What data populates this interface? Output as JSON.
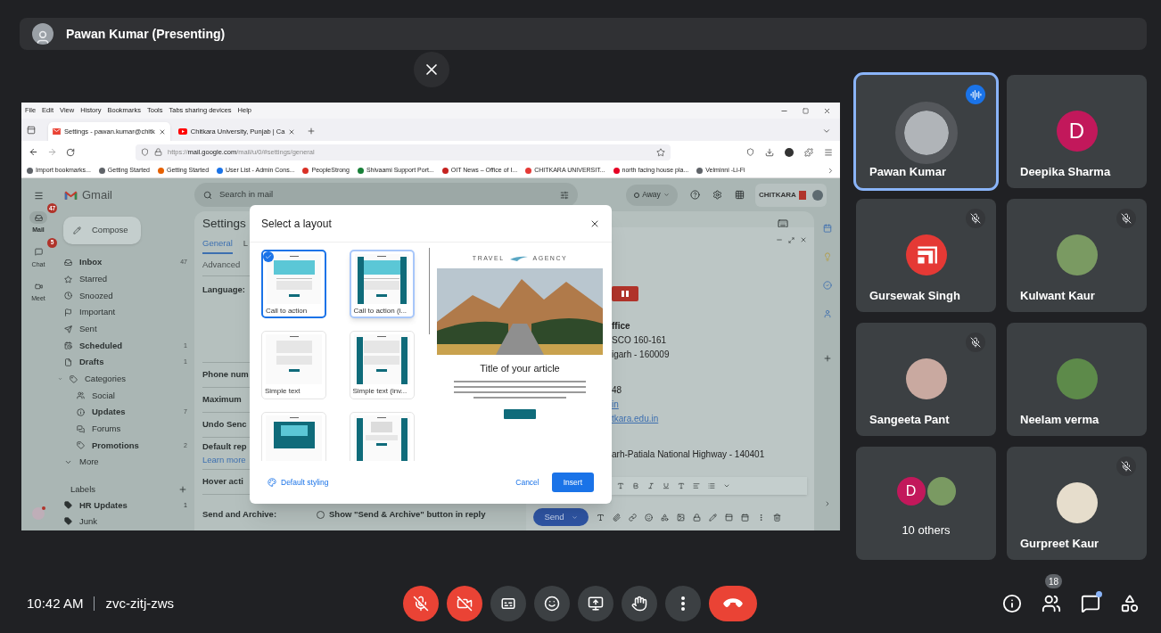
{
  "top_bar": {
    "presenter": "Pawan Kumar (Presenting)"
  },
  "shared_screen": {
    "menu": [
      "File",
      "Edit",
      "View",
      "History",
      "Bookmarks",
      "Tools",
      "Tabs sharing devices",
      "Help"
    ],
    "tabs": [
      {
        "title": "Settings - pawan.kumar@chitk",
        "selected": true
      },
      {
        "title": "Chitkara University, Punjab | Ca",
        "selected": false
      }
    ],
    "url": "https://**mail.google.com**/mail/u/0/#settings/general",
    "bookmarks": [
      {
        "label": "Import bookmarks...",
        "color": "#5f6368"
      },
      {
        "label": "Getting Started",
        "color": "#5f6368"
      },
      {
        "label": "Getting Started",
        "color": "#e66000"
      },
      {
        "label": "User List - Admin Cons...",
        "color": "#1a73e8"
      },
      {
        "label": "PeopleStrong",
        "color": "#d93025"
      },
      {
        "label": "Shivaami Support Port...",
        "color": "#188038"
      },
      {
        "label": "OIT News – Office of I...",
        "color": "#c5221f"
      },
      {
        "label": "CHITKARA UNIVERSIT...",
        "color": "#e53935"
      },
      {
        "label": "north facing house pla...",
        "color": "#e60023"
      },
      {
        "label": "Velminni -Li-Fi",
        "color": "#5f6368"
      }
    ],
    "gmail": {
      "app_name": "Gmail",
      "rail": [
        {
          "label": "Mail",
          "badge": "47",
          "selected": true
        },
        {
          "label": "Chat",
          "badge": "5",
          "selected": false
        },
        {
          "label": "Meet",
          "selected": false
        }
      ],
      "compose": "Compose",
      "nav": [
        {
          "label": "Inbox",
          "count": "47",
          "unread": true
        },
        {
          "label": "Starred",
          "unread": false
        },
        {
          "label": "Snoozed",
          "unread": false
        },
        {
          "label": "Important",
          "unread": false
        },
        {
          "label": "Sent",
          "unread": false
        },
        {
          "label": "Scheduled",
          "count": "1",
          "unread": true
        },
        {
          "label": "Drafts",
          "count": "1",
          "unread": true
        },
        {
          "label": "Categories",
          "unread": false,
          "expanded": true,
          "children": [
            {
              "label": "Social",
              "unread": false
            },
            {
              "label": "Updates",
              "count": "7",
              "unread": true
            },
            {
              "label": "Forums",
              "unread": false
            },
            {
              "label": "Promotions",
              "count": "2",
              "unread": true
            }
          ]
        },
        {
          "label": "More",
          "unread": false
        }
      ],
      "labels_heading": "Labels",
      "labels": [
        {
          "label": "HR Updates",
          "count": "1",
          "unread": true
        },
        {
          "label": "Junk",
          "unread": false
        }
      ],
      "search_placeholder": "Search in mail",
      "status": "Away",
      "org_logo": "CHITKARA",
      "settings": {
        "title": "Settings",
        "tabs": [
          {
            "label": "General",
            "selected": true
          },
          {
            "label": "L",
            "selected": false
          }
        ],
        "tabs_second_row": [
          {
            "label": "Advanced",
            "selected": false
          }
        ],
        "rows": [
          {
            "label": "Language:",
            "kind": "tall"
          },
          {
            "label": "Phone num",
            "kind": "plain"
          },
          {
            "label": "Maximum",
            "kind": "plain"
          },
          {
            "label": "Undo Senc",
            "kind": "plain"
          },
          {
            "label": "Default rep",
            "kind": "link",
            "link": "Learn more"
          },
          {
            "label": "Hover acti",
            "kind": "plain"
          },
          {
            "label": "Send and Archive:",
            "kind": "radio",
            "option": "Show \"Send & Archive\" button in reply",
            "checked": false
          }
        ]
      },
      "compose_window": {
        "blocks": [
          [
            {
              "text": "ffice",
              "kind": "bold"
            },
            {
              "text": "SCO 160-161",
              "kind": "plain"
            },
            {
              "text": "igarh - 160009",
              "kind": "plain"
            }
          ],
          [
            {
              "text": "48",
              "kind": "plain"
            },
            {
              "text": "in",
              "kind": "link"
            },
            {
              "text": "tkara.edu.in",
              "kind": "link"
            }
          ],
          [
            {
              "text": "arh-Patiala National Highway - 140401",
              "kind": "plain"
            }
          ]
        ],
        "send": "Send"
      }
    },
    "dialog": {
      "title": "Select a layout",
      "layouts": [
        {
          "label": "Call to action",
          "kind": "image",
          "inverse": false,
          "selected": true,
          "hovered": false
        },
        {
          "label": "Call to action (i...",
          "kind": "image",
          "inverse": true,
          "selected": false,
          "hovered": true
        },
        {
          "label": "Simple text",
          "kind": "text",
          "inverse": false,
          "selected": false,
          "hovered": false
        },
        {
          "label": "Simple text (inv...",
          "kind": "text",
          "inverse": true,
          "selected": false,
          "hovered": false
        },
        {
          "kind": "card",
          "inverse": false,
          "selected": false,
          "hovered": false
        },
        {
          "kind": "gray",
          "inverse": true,
          "selected": false,
          "hovered": false
        }
      ],
      "preview": {
        "brand_left": "TRAVEL",
        "brand_right": "AGENCY",
        "title": "Title of your article"
      },
      "styling": "Default styling",
      "cancel": "Cancel",
      "insert": "Insert"
    }
  },
  "participants": [
    {
      "name": "Pawan Kumar",
      "kind": "photo",
      "color": "#b0b4b8",
      "speaking": true,
      "muted": false
    },
    {
      "name": "Deepika Sharma",
      "kind": "letter",
      "initial": "D",
      "color": "#c2185b",
      "speaking": false,
      "muted": false
    },
    {
      "name": "Gursewak Singh",
      "kind": "logo",
      "color": "#e53935",
      "speaking": false,
      "muted": true
    },
    {
      "name": "Kulwant Kaur",
      "kind": "photo",
      "color": "#7a9a62",
      "speaking": false,
      "muted": true
    },
    {
      "name": "Sangeeta Pant",
      "kind": "photo",
      "color": "#c9a9a0",
      "speaking": false,
      "muted": true
    },
    {
      "name": "Neelam verma",
      "kind": "photo",
      "color": "#5d8a4a",
      "speaking": false,
      "muted": false
    },
    {
      "name": "10 others",
      "kind": "group",
      "speaking": false,
      "muted": false,
      "avatars": [
        {
          "kind": "letter",
          "initial": "D",
          "color": "#c2185b"
        },
        {
          "kind": "photo",
          "color": "#7a9a62"
        }
      ]
    },
    {
      "name": "Gurpreet Kaur",
      "kind": "photo",
      "color": "#e6ddcc",
      "speaking": false,
      "muted": true
    }
  ],
  "bottom_bar": {
    "time": "10:42 AM",
    "meeting_code": "zvc-zitj-zws",
    "mic_on": false,
    "camera_on": false,
    "people_count": "18",
    "chat_unread": true
  }
}
